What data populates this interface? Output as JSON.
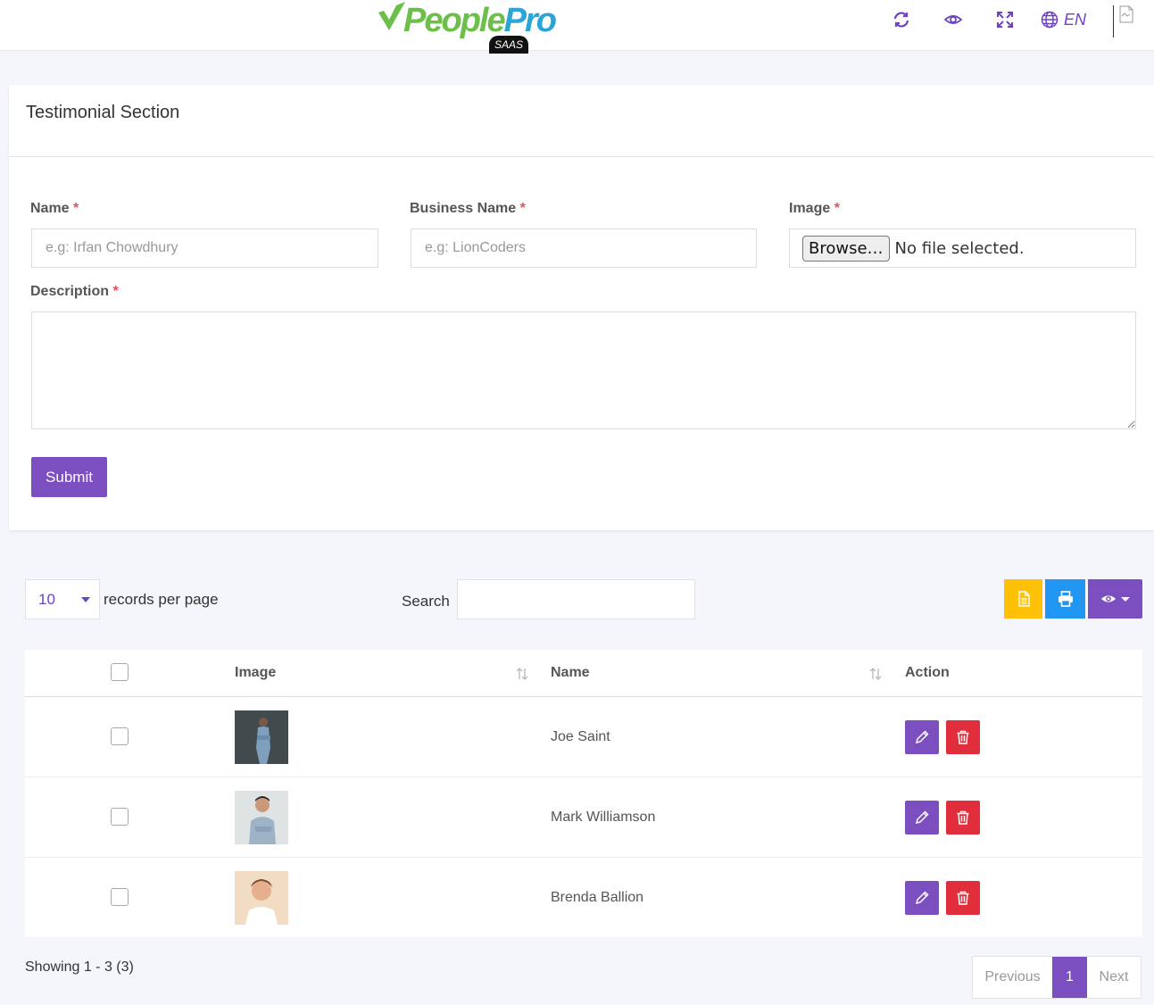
{
  "header": {
    "logo_text_main": "People",
    "logo_text_accent": "Pro",
    "logo_badge": "SAAS",
    "language": "EN",
    "colors": {
      "accent": "#6f42c1",
      "logo_green": "#6cc04a",
      "logo_blue": "#2aa5d8"
    }
  },
  "form": {
    "title": "Testimonial Section",
    "name_label": "Name",
    "name_placeholder": "e.g: Irfan Chowdhury",
    "business_label": "Business Name",
    "business_placeholder": "e.g: LionCoders",
    "image_label": "Image",
    "browse_label": "Browse…",
    "no_file_text": "No file selected.",
    "description_label": "Description",
    "required_mark": "*",
    "submit_label": "Submit"
  },
  "table_controls": {
    "per_page_value": "10",
    "per_page_label": "records per page",
    "search_label": "Search",
    "colors": {
      "csv": "#ffc107",
      "print": "#2196f3",
      "columns": "#7c4fc1"
    }
  },
  "table": {
    "columns": {
      "image": "Image",
      "name": "Name",
      "action": "Action"
    },
    "rows": [
      {
        "name": "Joe Saint"
      },
      {
        "name": "Mark Williamson"
      },
      {
        "name": "Brenda Ballion"
      }
    ]
  },
  "footer": {
    "showing_text": "Showing 1 - 3 (3)",
    "prev_label": "Previous",
    "current_page": "1",
    "next_label": "Next"
  }
}
